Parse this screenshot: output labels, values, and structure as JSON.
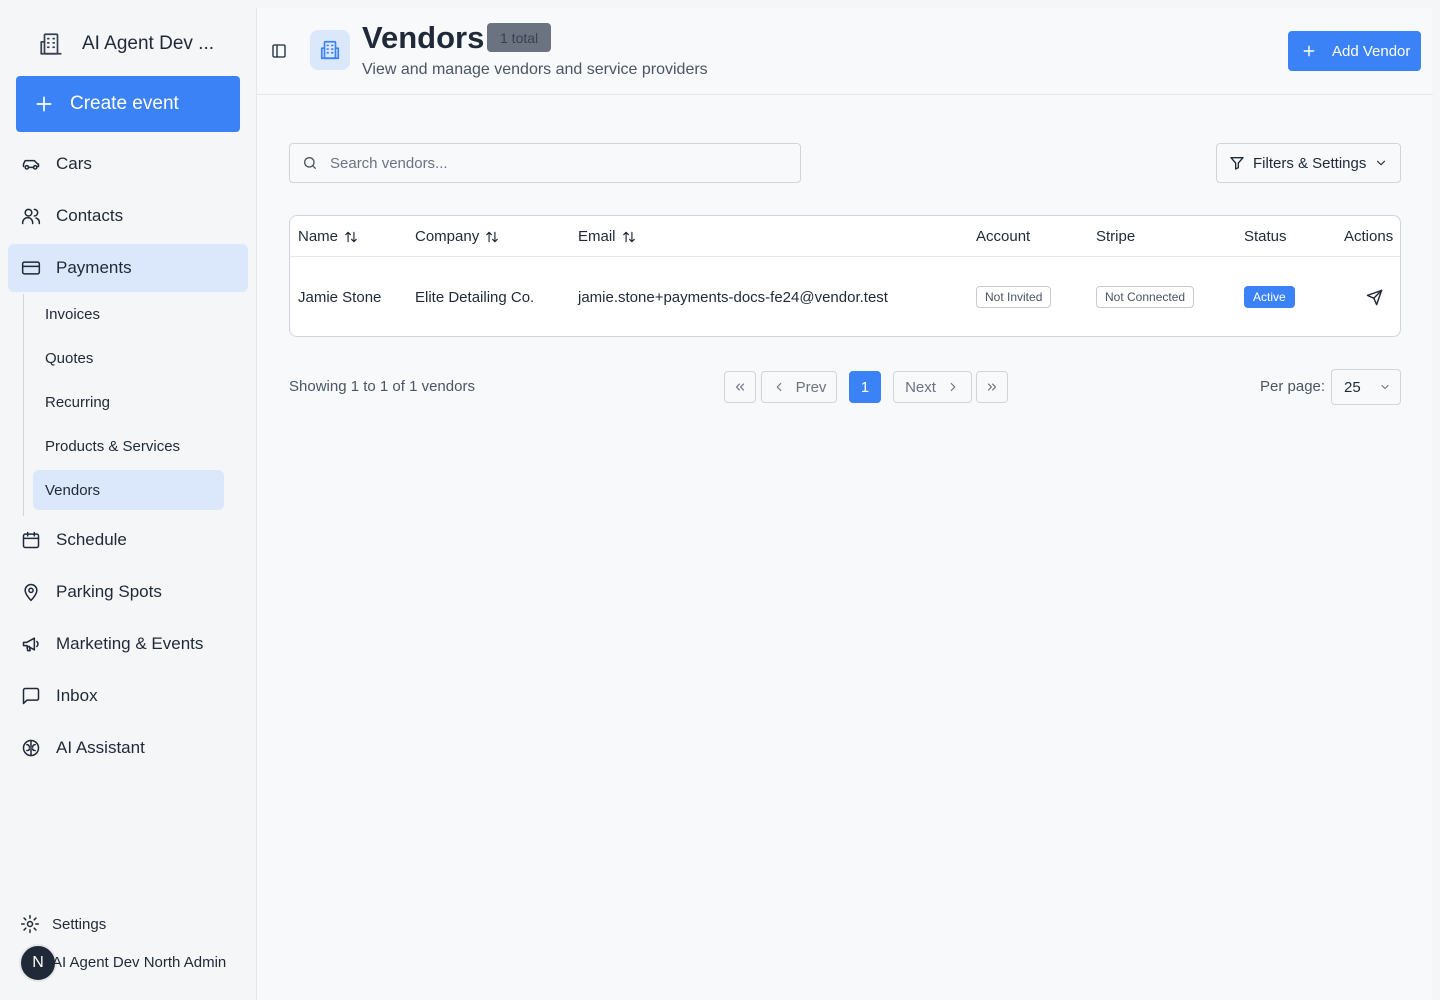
{
  "sidebar": {
    "brand": {
      "label": "AI Agent Dev ...",
      "icon": "building-icon"
    },
    "create_button": {
      "label": "Create event",
      "icon": "plus-icon"
    },
    "items": [
      {
        "label": "Cars",
        "icon": "car-icon",
        "active": false
      },
      {
        "label": "Contacts",
        "icon": "users-icon",
        "active": false
      },
      {
        "label": "Payments",
        "icon": "credit-card-icon",
        "active": true
      },
      {
        "label": "Schedule",
        "icon": "calendar-icon",
        "active": false
      },
      {
        "label": "Parking Spots",
        "icon": "map-pin-icon",
        "active": false
      },
      {
        "label": "Marketing & Events",
        "icon": "megaphone-icon",
        "active": false
      },
      {
        "label": "Inbox",
        "icon": "message-square-icon",
        "active": false
      },
      {
        "label": "AI Assistant",
        "icon": "brain-icon",
        "active": false
      }
    ],
    "payments_subitems": [
      {
        "label": "Invoices",
        "active": false
      },
      {
        "label": "Quotes",
        "active": false
      },
      {
        "label": "Recurring",
        "active": false
      },
      {
        "label": "Products & Services",
        "active": false
      },
      {
        "label": "Vendors",
        "active": true
      }
    ],
    "settings_label": "Settings",
    "user": {
      "initial": "N",
      "name": "AI Agent Dev North Admin"
    }
  },
  "header": {
    "title": "Vendors",
    "badge": "1 total",
    "subtitle": "View and manage vendors and service providers",
    "add_button": "Add Vendor"
  },
  "toolbar": {
    "search_placeholder": "Search vendors...",
    "filters_label": "Filters & Settings"
  },
  "table": {
    "columns": {
      "name": "Name",
      "company": "Company",
      "email": "Email",
      "account": "Account",
      "stripe": "Stripe",
      "status": "Status",
      "actions": "Actions"
    },
    "rows": [
      {
        "name": "Jamie Stone",
        "company": "Elite Detailing Co.",
        "email": "jamie.stone+payments-docs-fe24@vendor.test",
        "account": "Not Invited",
        "stripe": "Not Connected",
        "status": "Active",
        "action_icon": "send-icon"
      }
    ]
  },
  "pagination": {
    "summary": "Showing 1 to 1 of 1 vendors",
    "prev_label": "Prev",
    "next_label": "Next",
    "current_page": "1",
    "per_page_label": "Per page:",
    "per_page_value": "25"
  },
  "colors": {
    "accent": "#3b82f6",
    "active_nav_bg": "#dbe7fb",
    "badge_bg": "#6b7280"
  }
}
